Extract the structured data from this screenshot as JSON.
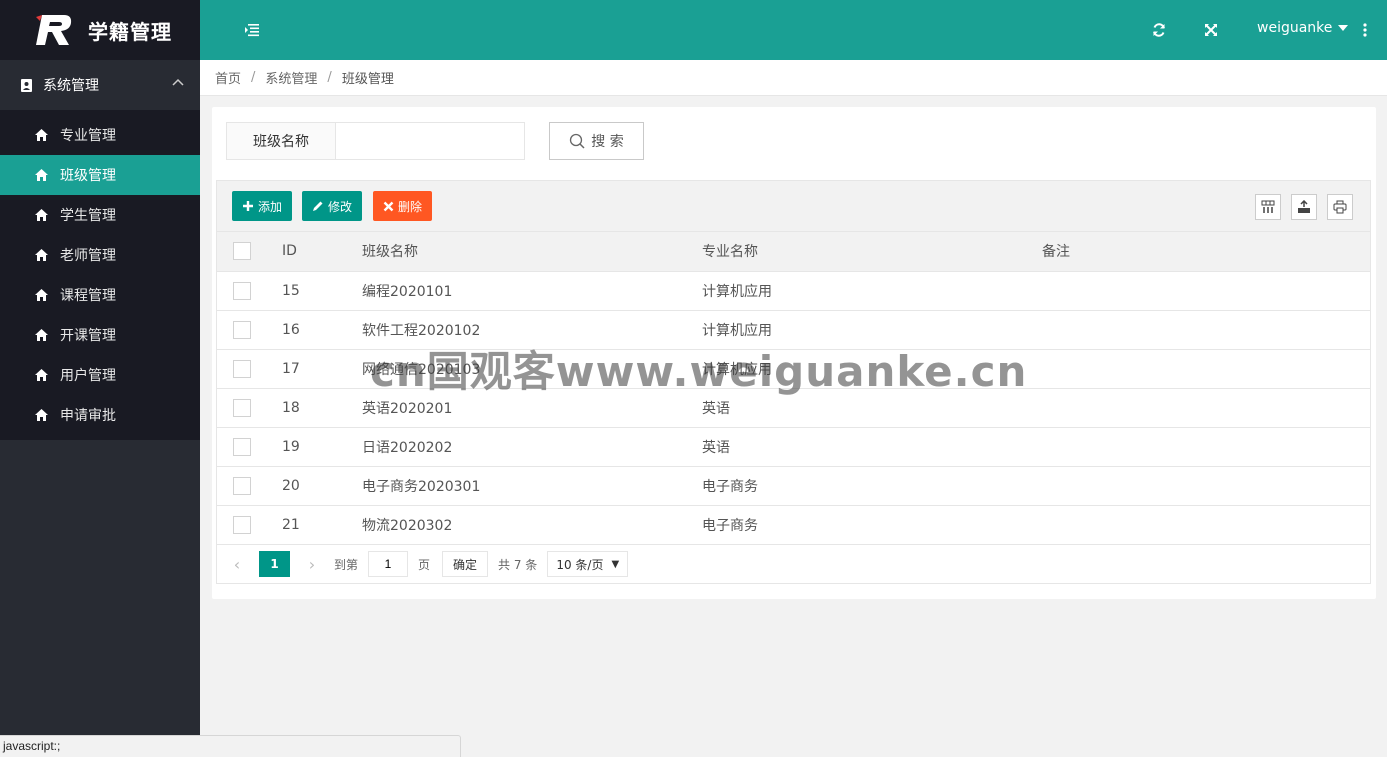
{
  "app": {
    "title": "学籍管理"
  },
  "sidebar": {
    "group_label": "系统管理",
    "items": [
      {
        "label": "专业管理",
        "active": false
      },
      {
        "label": "班级管理",
        "active": true
      },
      {
        "label": "学生管理",
        "active": false
      },
      {
        "label": "老师管理",
        "active": false
      },
      {
        "label": "课程管理",
        "active": false
      },
      {
        "label": "开课管理",
        "active": false
      },
      {
        "label": "用户管理",
        "active": false
      },
      {
        "label": "申请审批",
        "active": false
      }
    ]
  },
  "header": {
    "username": "weiguanke"
  },
  "breadcrumb": [
    "首页",
    "系统管理",
    "班级管理"
  ],
  "search": {
    "label": "班级名称",
    "value": "",
    "button": "搜 索"
  },
  "toolbar": {
    "add": "添加",
    "edit": "修改",
    "delete": "删除"
  },
  "table": {
    "columns": [
      "ID",
      "班级名称",
      "专业名称",
      "备注"
    ],
    "rows": [
      [
        "15",
        "编程2020101",
        "计算机应用",
        ""
      ],
      [
        "16",
        "软件工程2020102",
        "计算机应用",
        ""
      ],
      [
        "17",
        "网络通信2020103",
        "计算机应用",
        ""
      ],
      [
        "18",
        "英语2020201",
        "英语",
        ""
      ],
      [
        "19",
        "日语2020202",
        "英语",
        ""
      ],
      [
        "20",
        "电子商务2020301",
        "电子商务",
        ""
      ],
      [
        "21",
        "物流2020302",
        "电子商务",
        ""
      ]
    ]
  },
  "pager": {
    "current": "1",
    "goto_label": "到第",
    "goto_value": "1",
    "page_label": "页",
    "confirm": "确定",
    "total": "共 7 条",
    "page_size": "10 条/页"
  },
  "status_bar": "javascript:;",
  "watermark": "cn国观客www.weiguanke.cn",
  "colors": {
    "primary": "#1aa094",
    "button_green": "#009688",
    "button_red": "#ff5722",
    "sidebar": "#282b33",
    "sidebar_dark": "#191a23"
  }
}
